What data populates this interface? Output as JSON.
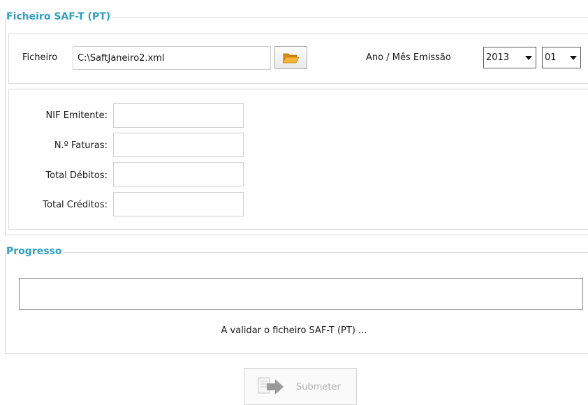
{
  "saft_section": {
    "legend": "Ficheiro SAF-T (PT)",
    "file_label": "Ficheiro",
    "file_value": "C:\\SaftJaneiro2.xml",
    "period_label": "Ano / Mês Emissão",
    "year_value": "2013",
    "month_value": "01",
    "fields": [
      {
        "label": "NIF Emitente:",
        "value": ""
      },
      {
        "label": "N.º Faturas:",
        "value": ""
      },
      {
        "label": "Total Débitos:",
        "value": ""
      },
      {
        "label": "Total Créditos:",
        "value": ""
      }
    ]
  },
  "progress_section": {
    "legend": "Progresso",
    "progress_fraction": 0,
    "status_text": "A validar o ficheiro SAF-T (PT) ..."
  },
  "submit": {
    "label": "Submeter",
    "enabled": false
  },
  "icons": {
    "browse": "folder-open-icon",
    "submit": "submit-arrow-icon"
  },
  "colors": {
    "legend": "#2f9fc2",
    "folder": "#f0a51c"
  }
}
